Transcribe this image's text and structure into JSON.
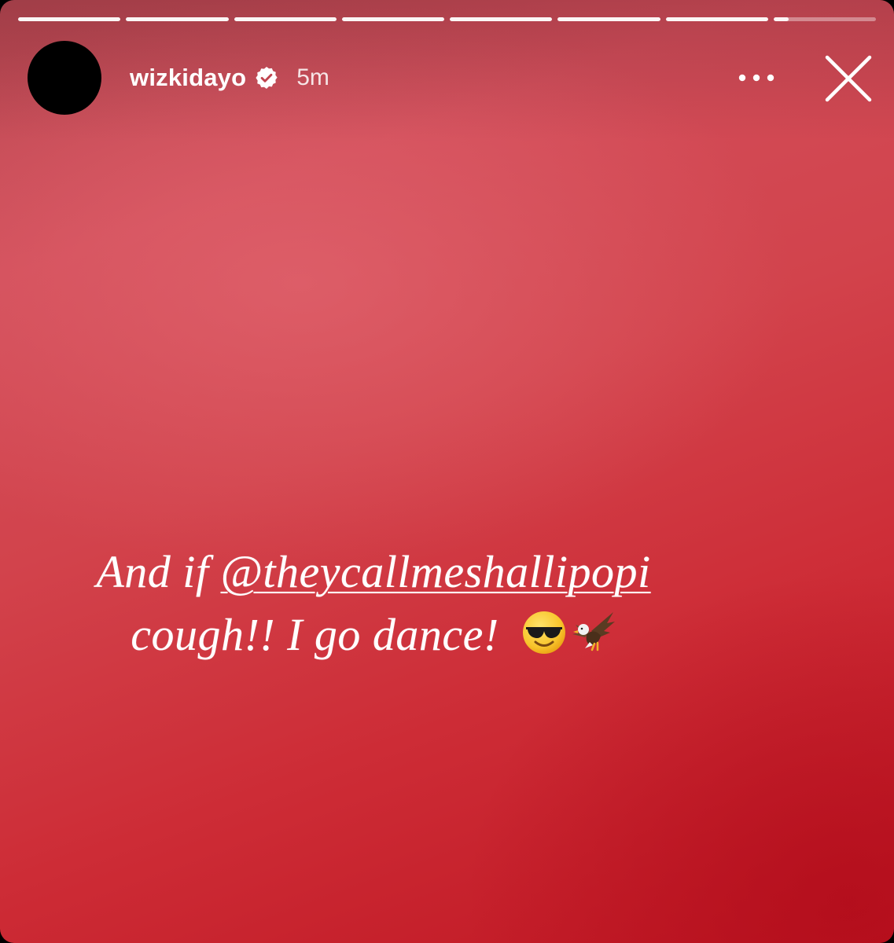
{
  "story": {
    "progress": {
      "segments_total": 8,
      "current_segment_fill": 0.15
    },
    "author": {
      "username": "wizkidayo",
      "verified": true,
      "timestamp": "5m"
    },
    "caption": {
      "line1_prefix": "And if ",
      "mention": "@theycallmeshallipopi",
      "line2": "cough!! I go dance! ",
      "emojis": [
        "smiling-face-with-sunglasses",
        "eagle"
      ]
    },
    "icons": {
      "more": "more-options-icon",
      "close": "close-icon",
      "verified": "verified-badge-icon"
    },
    "colors": {
      "background_top": "#b84852",
      "background_bottom": "#bf1622",
      "text": "#ffffff"
    }
  }
}
